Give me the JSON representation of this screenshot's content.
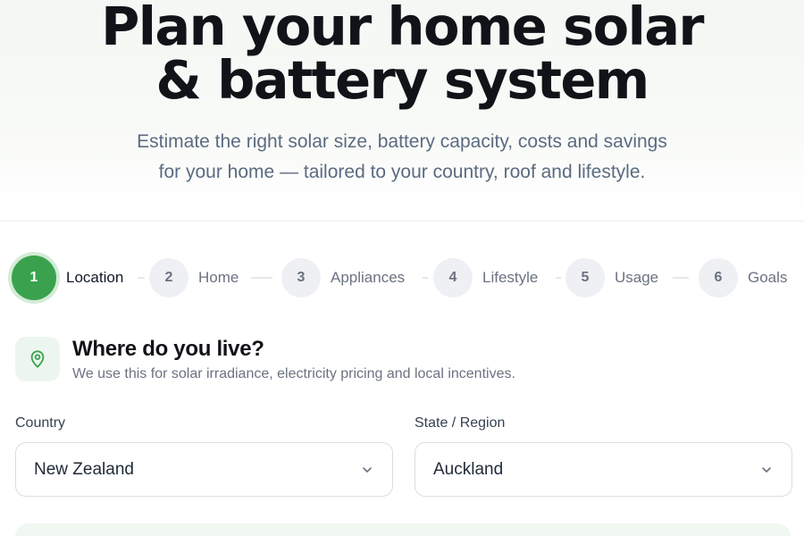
{
  "hero": {
    "title_line1": "Plan your home solar",
    "title_line2": "& battery system",
    "subtitle_line1": "Estimate the right solar size, battery capacity, costs and savings",
    "subtitle_line2": "for your home — tailored to your country, roof and lifestyle."
  },
  "stepper": {
    "active_step": 1,
    "steps": [
      {
        "number": "1",
        "label": "Location"
      },
      {
        "number": "2",
        "label": "Home"
      },
      {
        "number": "3",
        "label": "Appliances"
      },
      {
        "number": "4",
        "label": "Lifestyle"
      },
      {
        "number": "5",
        "label": "Usage"
      },
      {
        "number": "6",
        "label": "Goals"
      }
    ]
  },
  "section": {
    "icon": "map-pin-icon",
    "title": "Where do you live?",
    "subtitle": "We use this for solar irradiance, electricity pricing and local incentives."
  },
  "form": {
    "country": {
      "label": "Country",
      "value": "New Zealand"
    },
    "region": {
      "label": "State / Region",
      "value": "Auckland"
    }
  },
  "colors": {
    "accent": "#3aa24e",
    "accent_ring": "#d3ecd7",
    "icon_tint_bg": "#ecf6ee",
    "title_text": "#111318",
    "muted_text": "#6b7280",
    "subtitle_text": "#5b6b80",
    "border": "#d9dde3"
  }
}
